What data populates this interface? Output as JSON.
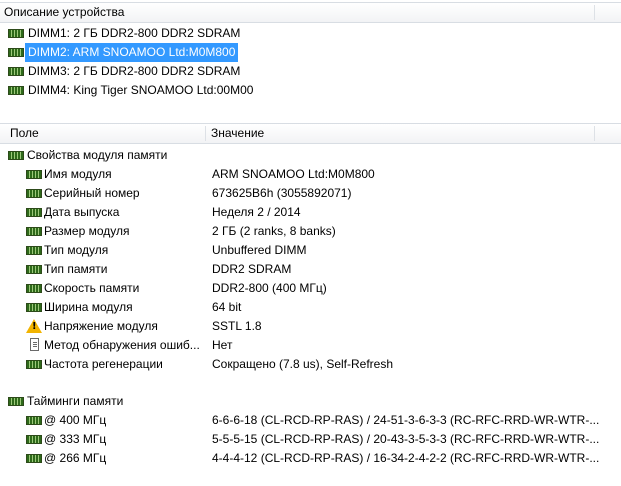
{
  "device_panel": {
    "header": "Описание устройства",
    "devices": [
      {
        "label": "DIMM1: 2 ГБ DDR2-800 DDR2 SDRAM",
        "selected": false
      },
      {
        "label": "DIMM2: ARM SNOAMOO Ltd:M0M800",
        "selected": true
      },
      {
        "label": "DIMM3: 2 ГБ DDR2-800 DDR2 SDRAM",
        "selected": false
      },
      {
        "label": "DIMM4: King Tiger SNOAMOO Ltd:00M00",
        "selected": false
      }
    ]
  },
  "details": {
    "col_field": "Поле",
    "col_value": "Значение",
    "group1": "Свойства модуля памяти",
    "props": [
      {
        "field": "Имя модуля",
        "value": "ARM SNOAMOO Ltd:M0M800",
        "icon": "ram-icon"
      },
      {
        "field": "Серийный номер",
        "value": "673625B6h (3055892071)",
        "icon": "ram-icon"
      },
      {
        "field": "Дата выпуска",
        "value": "Неделя 2 / 2014",
        "icon": "ram-icon"
      },
      {
        "field": "Размер модуля",
        "value": "2 ГБ (2 ranks, 8 banks)",
        "icon": "ram-icon"
      },
      {
        "field": "Тип модуля",
        "value": "Unbuffered DIMM",
        "icon": "ram-icon"
      },
      {
        "field": "Тип памяти",
        "value": "DDR2 SDRAM",
        "icon": "ram-icon"
      },
      {
        "field": "Скорость памяти",
        "value": "DDR2-800 (400 МГц)",
        "icon": "ram-icon"
      },
      {
        "field": "Ширина модуля",
        "value": "64 bit",
        "icon": "ram-icon"
      },
      {
        "field": "Напряжение модуля",
        "value": "SSTL 1.8",
        "icon": "warning-icon"
      },
      {
        "field": "Метод обнаружения ошиб...",
        "value": "Нет",
        "icon": "document-icon"
      },
      {
        "field": "Частота регенерации",
        "value": "Сокращено (7.8 us), Self-Refresh",
        "icon": "ram-icon"
      }
    ],
    "group2": "Тайминги памяти",
    "timings": [
      {
        "field": "@ 400 МГц",
        "value": "6-6-6-18  (CL-RCD-RP-RAS) / 24-51-3-6-3-3  (RC-RFC-RRD-WR-WTR-..."
      },
      {
        "field": "@ 333 МГц",
        "value": "5-5-5-15  (CL-RCD-RP-RAS) / 20-43-3-5-3-3  (RC-RFC-RRD-WR-WTR-..."
      },
      {
        "field": "@ 266 МГц",
        "value": "4-4-4-12  (CL-RCD-RP-RAS) / 16-34-2-4-2-2  (RC-RFC-RRD-WR-WTR-..."
      }
    ]
  }
}
